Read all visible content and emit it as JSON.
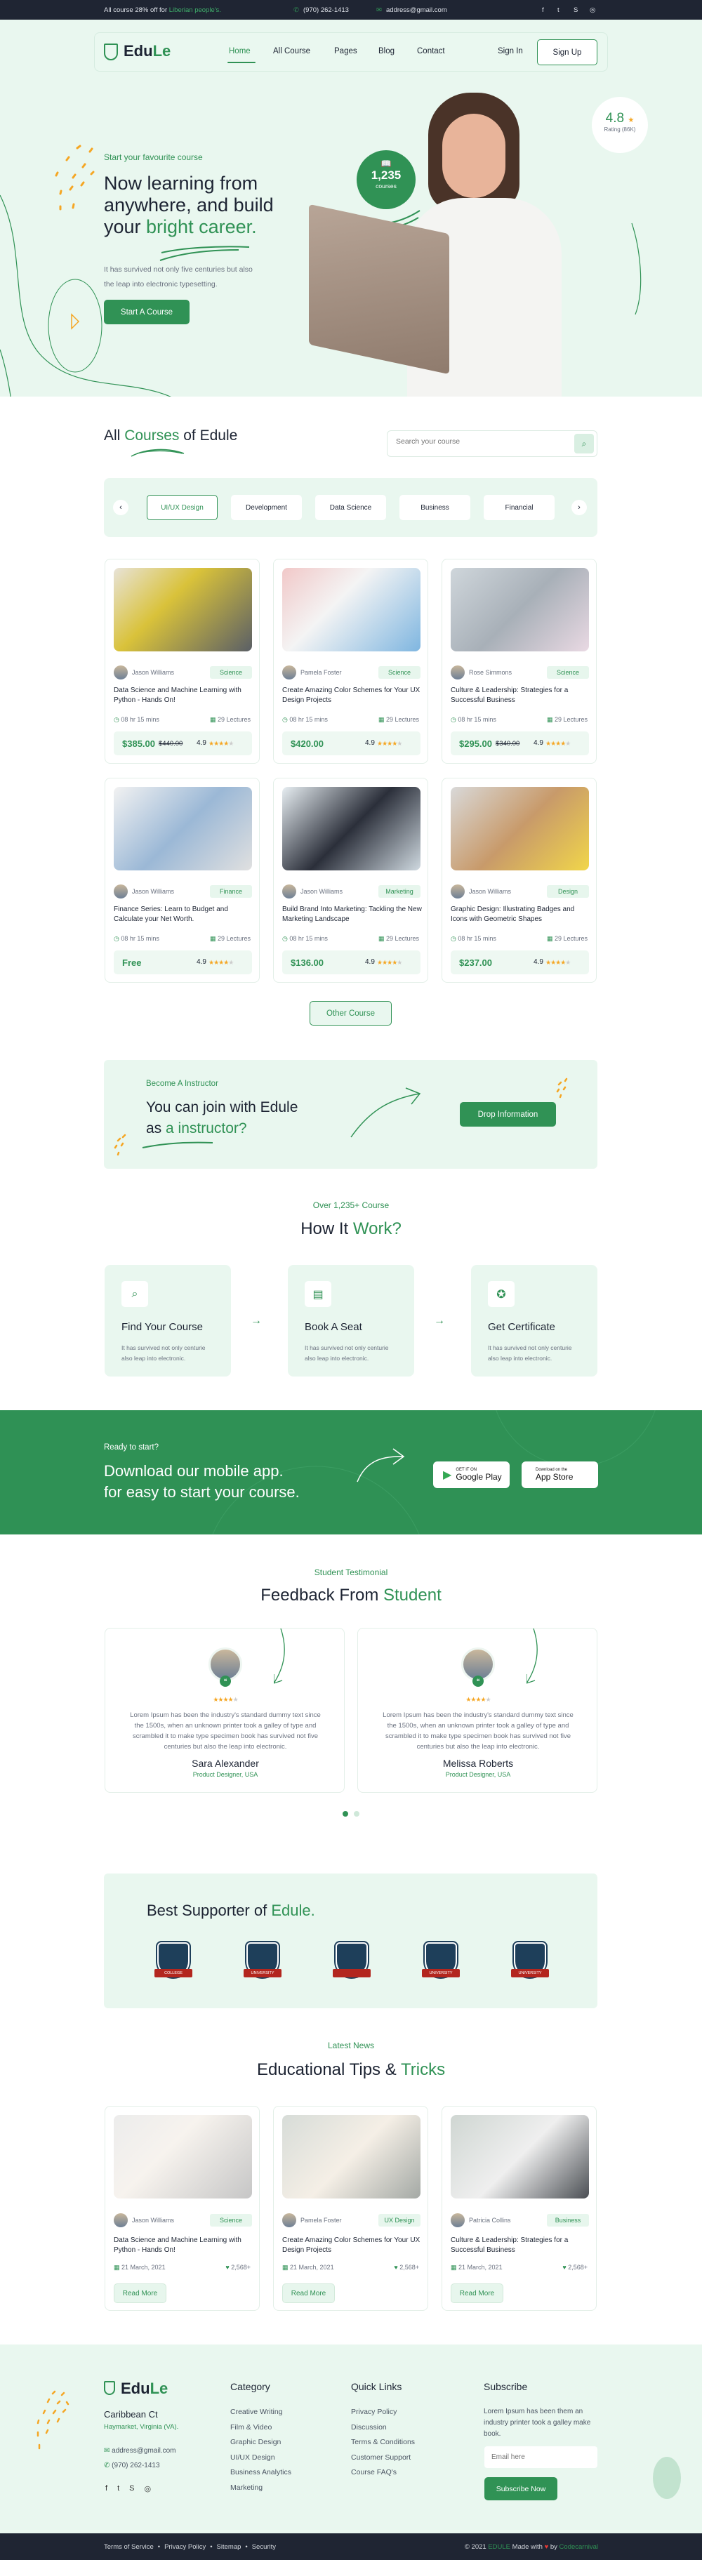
{
  "colors": {
    "brand": "#309255",
    "accent": "#f5a623",
    "dark": "#1f2533",
    "light_bg": "#e9f7ef"
  },
  "topbar": {
    "promo_prefix": "All course 28% off for ",
    "promo_highlight": "Liberian people's.",
    "phone": "(970) 262-1413",
    "email": "address@gmail.com",
    "social_icons": [
      "facebook-icon",
      "twitter-icon",
      "skype-icon",
      "instagram-icon"
    ]
  },
  "nav": {
    "logo_part1": "Edu",
    "logo_part2": "Le",
    "items": [
      "Home",
      "All Course",
      "Pages",
      "Blog",
      "Contact"
    ],
    "active": "Home",
    "sign_in": "Sign In",
    "sign_up": "Sign Up"
  },
  "hero": {
    "eyebrow": "Start your favourite course",
    "title_line1": "Now learning from",
    "title_line2": "anywhere, and build",
    "title_line3_prefix": "your ",
    "title_line3_highlight": "bright career.",
    "description_line1": "It has survived not only five centuries but also",
    "description_line2": "the leap into electronic typesetting.",
    "cta": "Start A Course",
    "courses_count": "1,235",
    "courses_label": "courses",
    "rating": "4.8",
    "rating_label": "Rating (86K)"
  },
  "courses": {
    "title_prefix": "All ",
    "title_highlight": "Courses",
    "title_suffix": " of Edule",
    "search_placeholder": "Search your course",
    "categories": [
      "UI/UX Design",
      "Development",
      "Data Science",
      "Business",
      "Financial"
    ],
    "active_category": "UI/UX Design",
    "other_button": "Other Course",
    "items": [
      {
        "author": "Jason Williams",
        "tag": "Science",
        "title": "Data Science and Machine Learning with Python - Hands On!",
        "duration": "08 hr 15 mins",
        "lectures": "29 Lectures",
        "price": "$385.00",
        "old_price": "$440.00",
        "rating": "4.9"
      },
      {
        "author": "Pamela Foster",
        "tag": "Science",
        "title": "Create Amazing Color Schemes for Your UX Design Projects",
        "duration": "08 hr 15 mins",
        "lectures": "29 Lectures",
        "price": "$420.00",
        "old_price": "",
        "rating": "4.9"
      },
      {
        "author": "Rose Simmons",
        "tag": "Science",
        "title": "Culture & Leadership: Strategies for a Successful Business",
        "duration": "08 hr 15 mins",
        "lectures": "29 Lectures",
        "price": "$295.00",
        "old_price": "$340.00",
        "rating": "4.9"
      },
      {
        "author": "Jason Williams",
        "tag": "Finance",
        "title": "Finance Series: Learn to Budget and Calculate your Net Worth.",
        "duration": "08 hr 15 mins",
        "lectures": "29 Lectures",
        "price": "Free",
        "old_price": "",
        "rating": "4.9"
      },
      {
        "author": "Jason Williams",
        "tag": "Marketing",
        "title": "Build Brand Into Marketing: Tackling the New Marketing Landscape",
        "duration": "08 hr 15 mins",
        "lectures": "29 Lectures",
        "price": "$136.00",
        "old_price": "",
        "rating": "4.9"
      },
      {
        "author": "Jason Williams",
        "tag": "Design",
        "title": "Graphic Design: Illustrating Badges and Icons with Geometric Shapes",
        "duration": "08 hr 15 mins",
        "lectures": "29 Lectures",
        "price": "$237.00",
        "old_price": "",
        "rating": "4.9"
      }
    ]
  },
  "instructor": {
    "eyebrow": "Become A Instructor",
    "title_line1": "You can join with Edule",
    "title_line2_prefix": "as ",
    "title_line2_highlight": "a instructor?",
    "button": "Drop Information"
  },
  "how": {
    "eyebrow": "Over 1,235+ Course",
    "title_prefix": "How It ",
    "title_highlight": "Work?",
    "steps": [
      {
        "icon": "search-icon",
        "title": "Find Your Course",
        "desc_line1": "It has survived not only centurie",
        "desc_line2": "also leap into electronic."
      },
      {
        "icon": "document-icon",
        "title": "Book A Seat",
        "desc_line1": "It has survived not only centurie",
        "desc_line2": "also leap into electronic."
      },
      {
        "icon": "certificate-icon",
        "title": "Get Certificate",
        "desc_line1": "It has survived not only centurie",
        "desc_line2": "also leap into electronic."
      }
    ]
  },
  "app": {
    "eyebrow": "Ready to start?",
    "title_line1": "Download our mobile app.",
    "title_line2": "for easy to start your course.",
    "google_small": "GET IT ON",
    "google_big": "Google Play",
    "apple_small": "Download on the",
    "apple_big": "App Store"
  },
  "testimonials": {
    "eyebrow": "Student Testimonial",
    "title_prefix": "Feedback From ",
    "title_highlight": "Student",
    "items": [
      {
        "text": "Lorem Ipsum has been the industry's standard dummy text since the 1500s, when an unknown printer took a galley of type and scrambled it to make type specimen book has survived not five centuries but also the leap into electronic.",
        "name": "Sara Alexander",
        "role": "Product Designer, USA",
        "rating": 4
      },
      {
        "text": "Lorem Ipsum has been the industry's standard dummy text since the 1500s, when an unknown printer took a galley of type and scrambled it to make type specimen book has survived not five centuries but also the leap into electronic.",
        "name": "Melissa Roberts",
        "role": "Product Designer, USA",
        "rating": 4
      }
    ],
    "page": 1,
    "pages": 2
  },
  "supporters": {
    "title_prefix": "Best Supporter of ",
    "title_highlight": "Edule.",
    "logos": [
      "COLLEGE",
      "UNIVERSITY",
      "",
      "UNIVERSITY",
      "UNIVERSITY"
    ]
  },
  "news": {
    "eyebrow": "Latest News",
    "title_prefix": "Educational Tips & ",
    "title_highlight": "Tricks",
    "items": [
      {
        "author": "Jason Williams",
        "tag": "Science",
        "title": "Data Science and Machine Learning with Python - Hands On!",
        "date": "21 March, 2021",
        "likes": "2,568+",
        "button": "Read More"
      },
      {
        "author": "Pamela Foster",
        "tag": "UX Design",
        "title": "Create Amazing Color Schemes for Your UX Design Projects",
        "date": "21 March, 2021",
        "likes": "2,568+",
        "button": "Read More"
      },
      {
        "author": "Patricia Collins",
        "tag": "Business",
        "title": "Culture & Leadership: Strategies for a Successful Business",
        "date": "21 March, 2021",
        "likes": "2,568+",
        "button": "Read More"
      }
    ]
  },
  "footer": {
    "address_title": "Caribbean Ct",
    "address_sub": "Haymarket, Virginia (VA).",
    "email": "address@gmail.com",
    "phone": "(970) 262-1413",
    "category_title": "Category",
    "categories": [
      "Creative Writing",
      "Film & Video",
      "Graphic Design",
      "UI/UX Design",
      "Business Analytics",
      "Marketing"
    ],
    "links_title": "Quick Links",
    "links": [
      "Privacy Policy",
      "Discussion",
      "Terms & Conditions",
      "Customer Support",
      "Course FAQ's"
    ],
    "subscribe_title": "Subscribe",
    "subscribe_text": "Lorem Ipsum has been them an industry printer took a galley make book.",
    "email_placeholder": "Email here",
    "subscribe_button": "Subscribe Now",
    "bottom_links": [
      "Terms of Service",
      "Privacy Policy",
      "Sitemap",
      "Security"
    ],
    "copyright_prefix": "© 2021 ",
    "copyright_brand": "EDULE",
    "copyright_mid": " Made with ",
    "copyright_by": " by ",
    "copyright_author": "Codecarnival"
  }
}
